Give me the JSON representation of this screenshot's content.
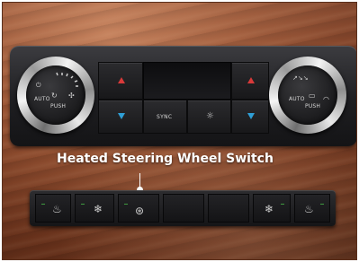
{
  "caption": "Heated Steering Wheel Switch",
  "left_knob": {
    "auto_label": "AUTO",
    "push_label": "PUSH"
  },
  "right_knob": {
    "auto_label": "AUTO",
    "push_label": "PUSH"
  },
  "center": {
    "sync_label": "SYNC"
  },
  "icons": {
    "left_knob_power": "power-icon",
    "left_knob_recirc": "recirculation-icon",
    "left_knob_fan": "fan-icon",
    "right_knob_airflow": "airflow-mode-icons",
    "right_knob_defrost": "defrost-icon",
    "center_rear_defrost": "sun-defrost-icon",
    "seat_heat": "heated-seat-icon",
    "seat_cool": "cooled-seat-icon",
    "steering_wheel_heat": "heated-steering-wheel-icon"
  },
  "colors": {
    "temp_up": "#d93a3a",
    "temp_down": "#2f9fd6",
    "indicator_led": "#3f9b3f"
  }
}
